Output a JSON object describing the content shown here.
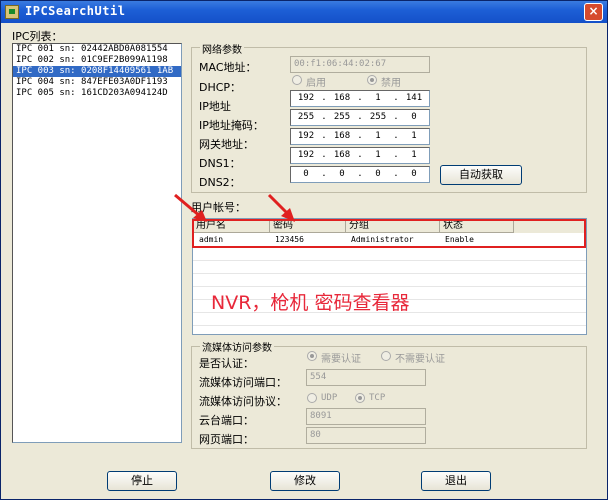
{
  "window": {
    "title": "IPCSearchUtil",
    "close_label": "×"
  },
  "ipc_list": {
    "label": "IPC列表：",
    "items": [
      "IPC 001  sn:  02442ABD0A081554",
      "IPC 002  sn:  01C9EF2B099A1198",
      "IPC 003  sn:  0208F14409561 1AB",
      "IPC 004  sn:  847EFE03A0DF1193",
      "IPC 005  sn:  161CD203A094124D"
    ],
    "selected_index": 2
  },
  "network": {
    "title": "网络参数",
    "mac_label": "MAC地址：",
    "mac_value": "00:f1:06:44:02:67",
    "dhcp_label": "DHCP：",
    "dhcp_on_label": "启用",
    "dhcp_off_label": "禁用",
    "ip_label": "IP地址",
    "ip": [
      "192",
      "168",
      "1",
      "141"
    ],
    "mask_label": "IP地址掩码：",
    "mask": [
      "255",
      "255",
      "255",
      "0"
    ],
    "gateway_label": "网关地址：",
    "gateway": [
      "192",
      "168",
      "1",
      "1"
    ],
    "dns1_label": "DNS1：",
    "dns1": [
      "192",
      "168",
      "1",
      "1"
    ],
    "dns2_label": "DNS2：",
    "dns2": [
      "0",
      "0",
      "0",
      "0"
    ],
    "auto_button": "自动获取"
  },
  "accounts": {
    "label": "用户帐号：",
    "columns": [
      "用户名",
      "密码",
      "分组",
      "状态"
    ],
    "rows": [
      {
        "user": "admin",
        "password": "123456",
        "group": "Administrator",
        "status": "Enable"
      }
    ]
  },
  "watermark": "NVR，枪机 密码查看器",
  "stream": {
    "title": "流媒体访问参数",
    "auth_label": "是否认证：",
    "auth_yes": "需要认证",
    "auth_no": "不需要认证",
    "port_label": "流媒体访问端口：",
    "port_value": "554",
    "protocol_label": "流媒体访问协议：",
    "udp_label": "UDP",
    "tcp_label": "TCP",
    "ptz_port_label": "云台端口：",
    "ptz_port_value": "8091",
    "web_port_label": "网页端口：",
    "web_port_value": "80"
  },
  "buttons": {
    "stop": "停止",
    "modify": "修改",
    "exit": "退出"
  },
  "colors": {
    "annotation_red": "#e02020",
    "selection_blue": "#316ac5"
  }
}
